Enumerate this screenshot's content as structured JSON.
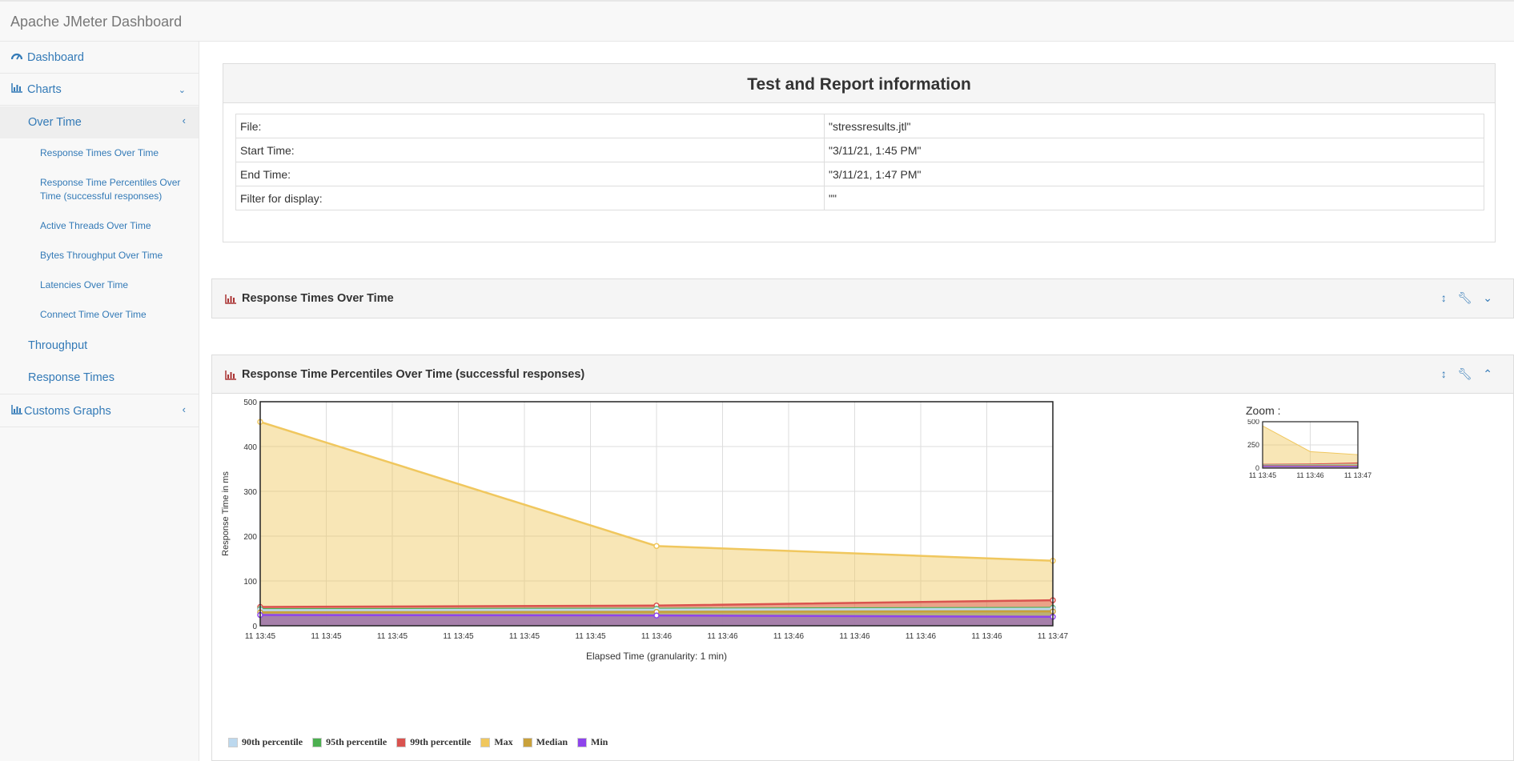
{
  "app": {
    "title": "Apache JMeter Dashboard"
  },
  "sidebar": {
    "dashboard": "Dashboard",
    "charts": "Charts",
    "over_time": "Over Time",
    "sub_items": [
      "Response Times Over Time",
      "Response Time Percentiles Over Time (successful responses)",
      "Active Threads Over Time",
      "Bytes Throughput Over Time",
      "Latencies Over Time",
      "Connect Time Over Time"
    ],
    "throughput": "Throughput",
    "response_times": "Response Times",
    "customs_graphs": "Customs Graphs"
  },
  "info": {
    "title": "Test and Report information",
    "rows": [
      {
        "label": "File:",
        "value": "\"stressresults.jtl\""
      },
      {
        "label": "Start Time:",
        "value": "\"3/11/21, 1:45 PM\""
      },
      {
        "label": "End Time:",
        "value": "\"3/11/21, 1:47 PM\""
      },
      {
        "label": "Filter for display:",
        "value": "\"\""
      }
    ]
  },
  "panels": {
    "response_times_title": "Response Times Over Time",
    "percentiles_title": "Response Time Percentiles Over Time (successful responses)"
  },
  "zoom": {
    "label": "Zoom :"
  },
  "colors": {
    "link": "#337ab7",
    "p90": "#bcd8ee",
    "p95": "#4caf50",
    "p99": "#d9534f",
    "max": "#f0c75e",
    "median": "#c9a13b",
    "min": "#8e44ec"
  },
  "chart_data": {
    "type": "area",
    "title": "Response Time Percentiles Over Time (successful responses)",
    "xlabel": "Elapsed Time (granularity: 1 min)",
    "ylabel": "Response Time in ms",
    "ylim": [
      0,
      500
    ],
    "yticks": [
      0,
      100,
      200,
      300,
      400,
      500
    ],
    "xticks": [
      "11 13:45",
      "11 13:45",
      "11 13:45",
      "11 13:45",
      "11 13:45",
      "11 13:45",
      "11 13:46",
      "11 13:46",
      "11 13:46",
      "11 13:46",
      "11 13:46",
      "11 13:46",
      "11 13:47"
    ],
    "x": [
      "11 13:45",
      "11 13:46",
      "11 13:47"
    ],
    "series": [
      {
        "name": "Max",
        "values": [
          455,
          178,
          145
        ]
      },
      {
        "name": "99th percentile",
        "values": [
          42,
          45,
          57
        ]
      },
      {
        "name": "95th percentile",
        "values": [
          37,
          38,
          40
        ]
      },
      {
        "name": "90th percentile",
        "values": [
          35,
          36,
          38
        ]
      },
      {
        "name": "Median",
        "values": [
          30,
          31,
          32
        ]
      },
      {
        "name": "Min",
        "values": [
          24,
          23,
          20
        ]
      }
    ],
    "legend": [
      "90th percentile",
      "95th percentile",
      "99th percentile",
      "Max",
      "Median",
      "Min"
    ],
    "grid": true,
    "zoom_yticks": [
      0,
      250,
      500
    ],
    "zoom_xticks": [
      "11 13:45",
      "11 13:46",
      "11 13:47"
    ]
  }
}
